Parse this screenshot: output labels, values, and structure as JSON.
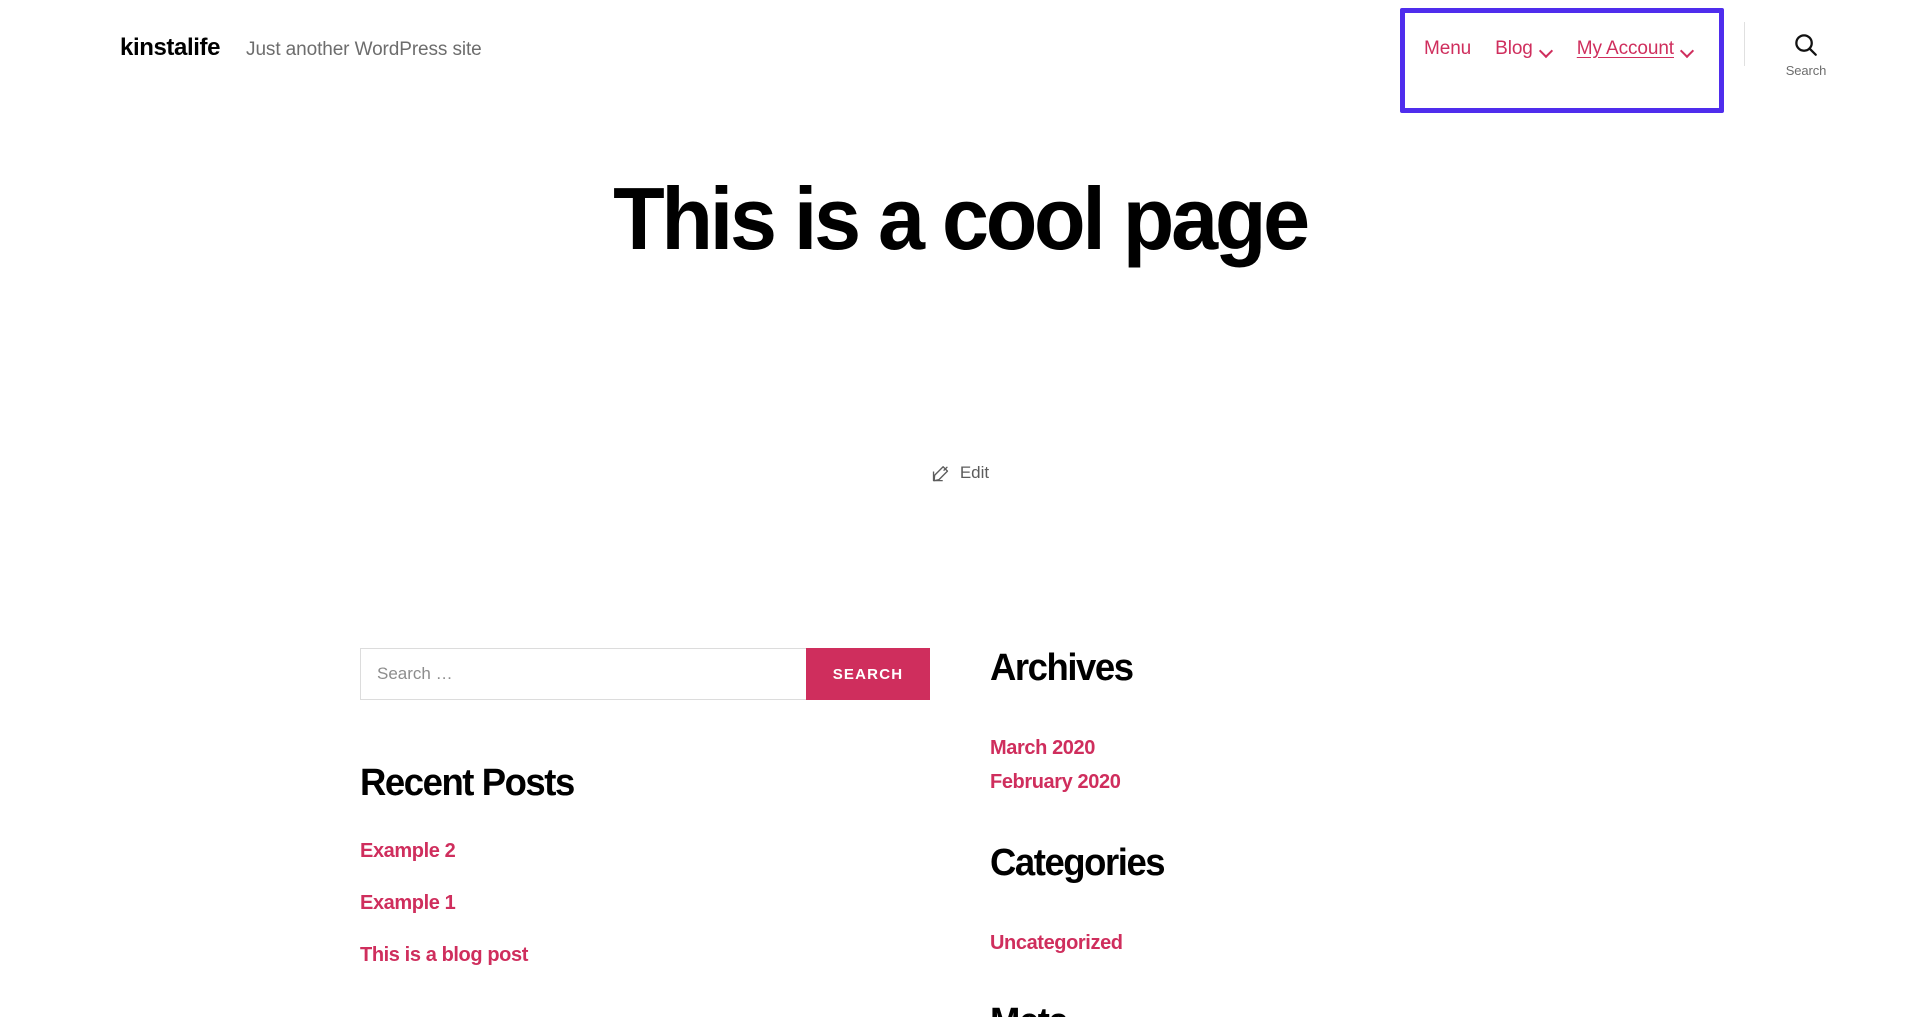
{
  "header": {
    "site_title": "kinstalife",
    "site_description": "Just another WordPress site",
    "nav": [
      {
        "label": "Menu",
        "has_dropdown": false,
        "current": false,
        "name": "nav-item-menu"
      },
      {
        "label": "Blog",
        "has_dropdown": true,
        "current": false,
        "name": "nav-item-blog"
      },
      {
        "label": "My Account",
        "has_dropdown": true,
        "current": true,
        "name": "nav-item-my-account"
      }
    ],
    "search_toggle_label": "Search"
  },
  "annotation": {
    "highlight_color": "#4f2ded",
    "target": "primary-navigation"
  },
  "main": {
    "page_title": "This is a cool page",
    "edit_label": "Edit"
  },
  "sidebar": {
    "search": {
      "placeholder": "Search …",
      "value": "",
      "button_label": "Search"
    },
    "recent_posts": {
      "title": "Recent Posts",
      "items": [
        "Example 2",
        "Example 1",
        "This is a blog post"
      ]
    },
    "archives": {
      "title": "Archives",
      "items": [
        "March 2020",
        "February 2020"
      ]
    },
    "categories": {
      "title": "Categories",
      "items": [
        "Uncategorized"
      ]
    },
    "meta": {
      "title": "Meta"
    }
  },
  "colors": {
    "accent": "#cf2e5d",
    "highlight": "#4f2ded",
    "text": "#000000",
    "muted": "#6d6d6d"
  }
}
